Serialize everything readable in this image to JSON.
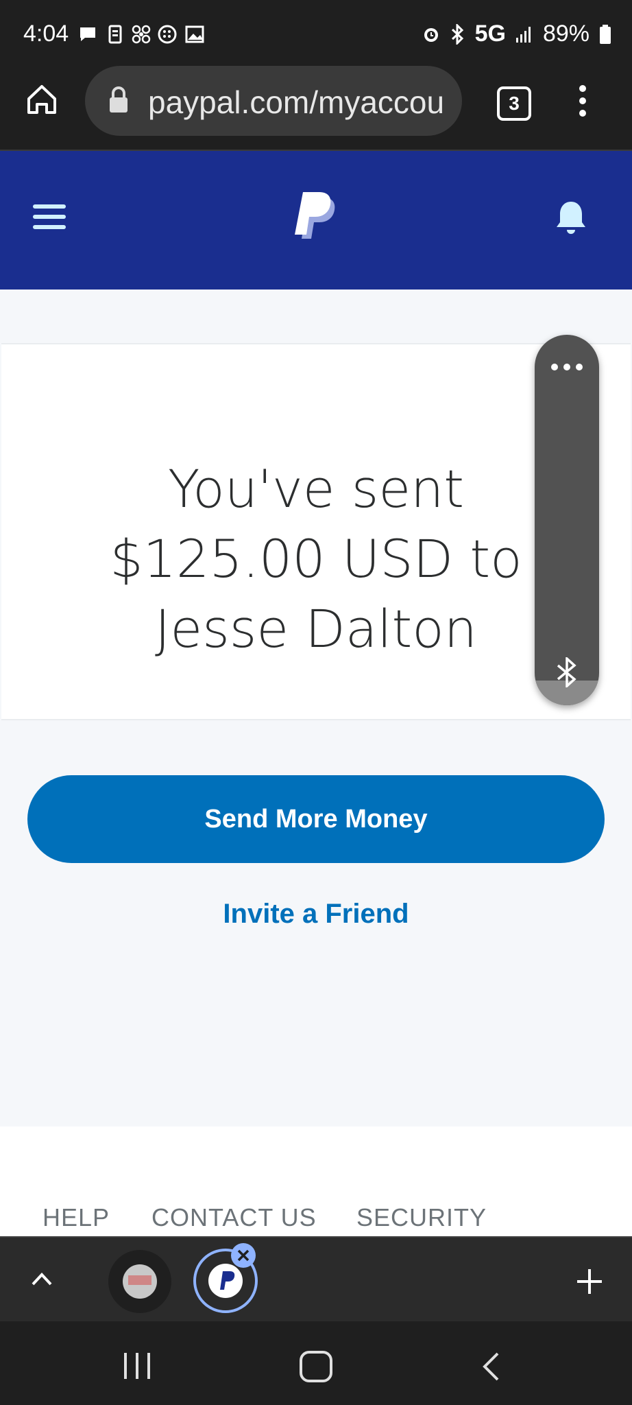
{
  "status_bar": {
    "time": "4:04",
    "network": "5G",
    "battery": "89%",
    "icons_left": [
      "message-icon",
      "sim-icon",
      "fan-icon",
      "blackberry-icon",
      "gallery-icon"
    ],
    "icons_right": [
      "alarm-icon",
      "bluetooth-icon",
      "signal-icon",
      "battery-icon"
    ]
  },
  "browser": {
    "url": "paypal.com/myaccou",
    "tab_count": "3"
  },
  "paypal": {
    "brand_color": "#1a2e8f",
    "message": [
      "You've sent",
      "$125.00 USD to",
      "Jesse Dalton"
    ],
    "send_more_label": "Send More Money",
    "invite_label": "Invite a Friend",
    "accent": "#0070ba"
  },
  "footer": {
    "links": [
      "HELP",
      "CONTACT US",
      "SECURITY"
    ]
  }
}
